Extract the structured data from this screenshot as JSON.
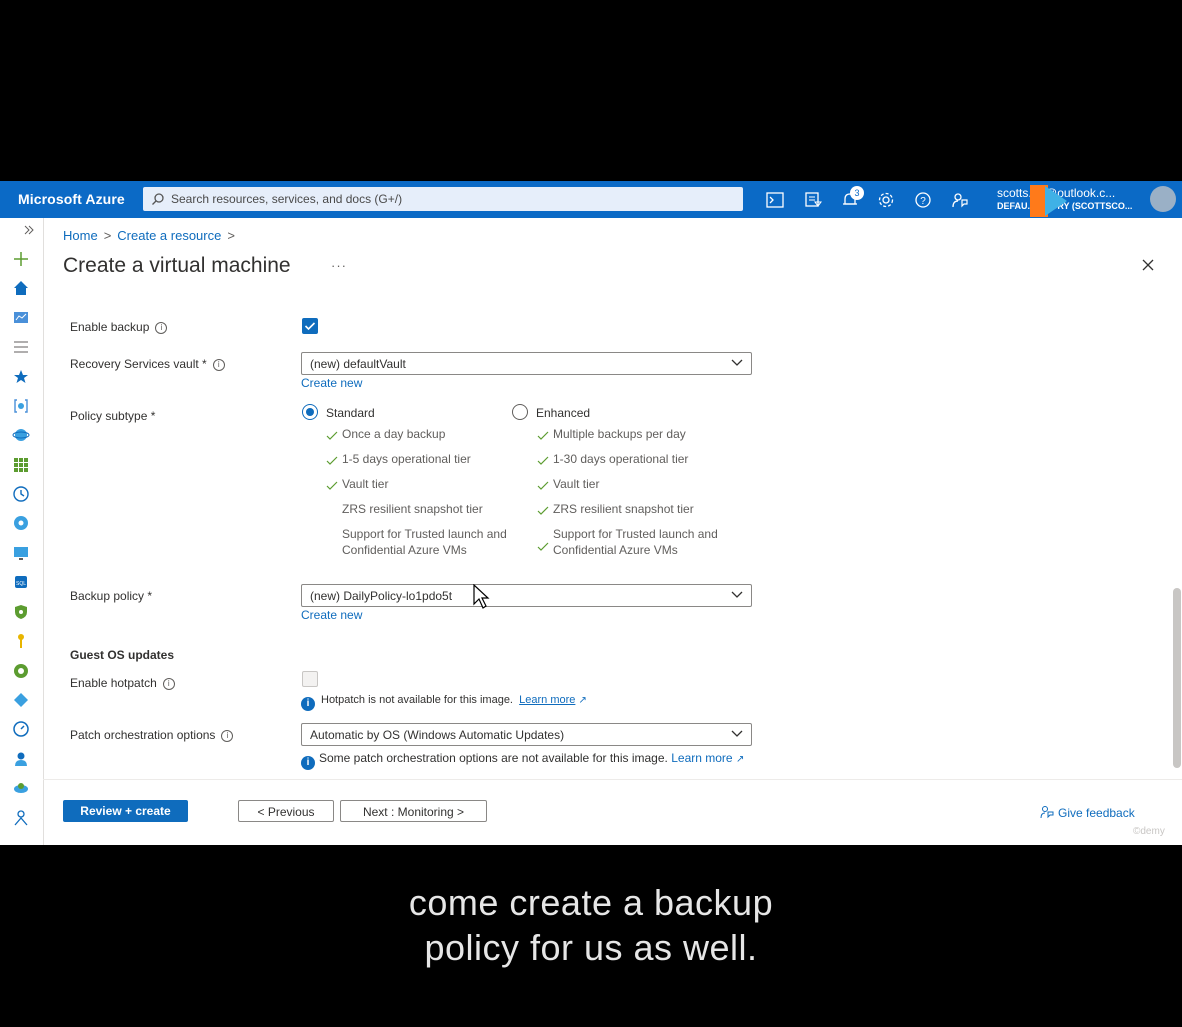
{
  "topbar": {
    "brand": "Microsoft Azure",
    "search_placeholder": "Search resources, services, and docs (G+/)",
    "notification_count": "3",
    "account_email": "scotts...e@outlook.c...",
    "account_directory": "DEFAU... ...TORY (SCOTTSCO..."
  },
  "breadcrumb": {
    "home": "Home",
    "create": "Create a resource"
  },
  "page": {
    "title": "Create a virtual machine",
    "more": "···"
  },
  "backup": {
    "enable_backup_label": "Enable backup",
    "vault_label": "Recovery Services vault *",
    "vault_value": "(new) defaultVault",
    "create_new": "Create new",
    "policy_subtype_label": "Policy subtype *",
    "standard": {
      "label": "Standard",
      "features": [
        "Once a day backup",
        "1-5 days operational tier",
        "Vault tier",
        "ZRS resilient snapshot tier",
        "Support for Trusted launch and Confidential Azure VMs"
      ]
    },
    "enhanced": {
      "label": "Enhanced",
      "features": [
        "Multiple backups per day",
        "1-30 days operational tier",
        "Vault tier",
        "ZRS resilient snapshot tier",
        "Support for Trusted launch and Confidential Azure VMs"
      ]
    },
    "backup_policy_label": "Backup policy *",
    "backup_policy_value": "(new) DailyPolicy-lo1pdo5t",
    "create_new_2": "Create new"
  },
  "guest": {
    "heading": "Guest OS updates",
    "hotpatch_label": "Enable hotpatch",
    "hotpatch_info": "Hotpatch is not available for this image.",
    "learn_more": "Learn more",
    "patch_label": "Patch orchestration options",
    "patch_value": "Automatic by OS (Windows Automatic Updates)",
    "patch_info": "Some patch orchestration options are not available for this image.",
    "learn_more_2": "Learn more"
  },
  "footer": {
    "review": "Review + create",
    "previous": "< Previous",
    "next": "Next : Monitoring >",
    "feedback": "Give feedback",
    "watermark": "©demy"
  },
  "subtitle": {
    "line1": "come create a backup",
    "line2": "policy for us as well."
  },
  "colors": {
    "azure_blue": "#0f6cbd",
    "topbar": "#0b6ac6"
  }
}
